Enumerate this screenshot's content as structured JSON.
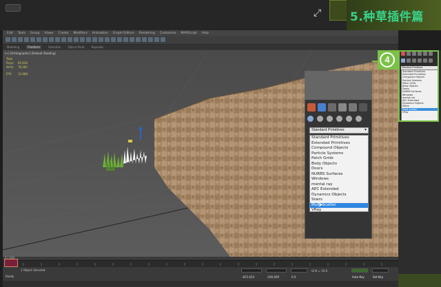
{
  "banner": {
    "brand_title": "5.种草插件篇"
  },
  "app": {
    "menu": [
      "Edit",
      "Tools",
      "Group",
      "Views",
      "Create",
      "Modifiers",
      "Animation",
      "Graph Editors",
      "Rendering",
      "Customize",
      "MAXScript",
      "Help"
    ],
    "ribbon_tabs": [
      "Modeling",
      "Freeform",
      "Selection",
      "Object Paint",
      "Populate"
    ],
    "active_tab": "Freeform"
  },
  "viewport": {
    "label": "[+] [Orthographic] [Default Shading]",
    "stats_total_label": "Total",
    "stats_rows": [
      {
        "label": "Polys:",
        "value": "85,626"
      },
      {
        "label": "Verts:",
        "value": "78,281"
      },
      {
        "label": "FPS:",
        "value": "33.688"
      }
    ]
  },
  "command_panel_small": {
    "selected": "Standard Primitives",
    "items": [
      "Standard Primitives",
      "Extended Primitives",
      "Compound Objects",
      "Particle Systems",
      "Patch Grids",
      "Body Objects",
      "Doors",
      "NURBS Surfaces",
      "Windows",
      "mental ray",
      "AEC Extended",
      "Dynamics Objects",
      "Stairs",
      "Multi Scatter",
      "VRay"
    ],
    "highlighted": "Multi Scatter"
  },
  "callout": {
    "number": "4"
  },
  "command_panel_big": {
    "selected": "Standard Primitives",
    "items": [
      "Standard Primitives",
      "Extended Primitives",
      "Compound Objects",
      "Particle Systems",
      "Patch Grids",
      "Body Objects",
      "Doors",
      "NURBS Surfaces",
      "Windows",
      "mental ray",
      "AEC Extended",
      "Dynamics Objects",
      "Stairs",
      "Multi Scatter",
      "VRay"
    ],
    "highlighted": "Multi Scatter"
  },
  "timeline": {
    "frame_label": "0 / 100",
    "ticks": [
      "0",
      "5",
      "10",
      "15",
      "20",
      "25",
      "30",
      "35",
      "40",
      "45",
      "50",
      "55",
      "60",
      "65",
      "70",
      "75",
      "80",
      "85",
      "90",
      "95",
      "100"
    ]
  },
  "status": {
    "selection": "1 Object Selected",
    "prompt": "Ready",
    "x_value": "-815.634",
    "y_value": "-166.009",
    "z_value": "0.0",
    "grid_label": "Grid = 10.0",
    "autokey": "Auto Key",
    "setkey": "Set Key"
  },
  "colors": {
    "accent_green": "#7bc146",
    "brand_text": "#39d28a",
    "selection_blue": "#2f86e0"
  }
}
